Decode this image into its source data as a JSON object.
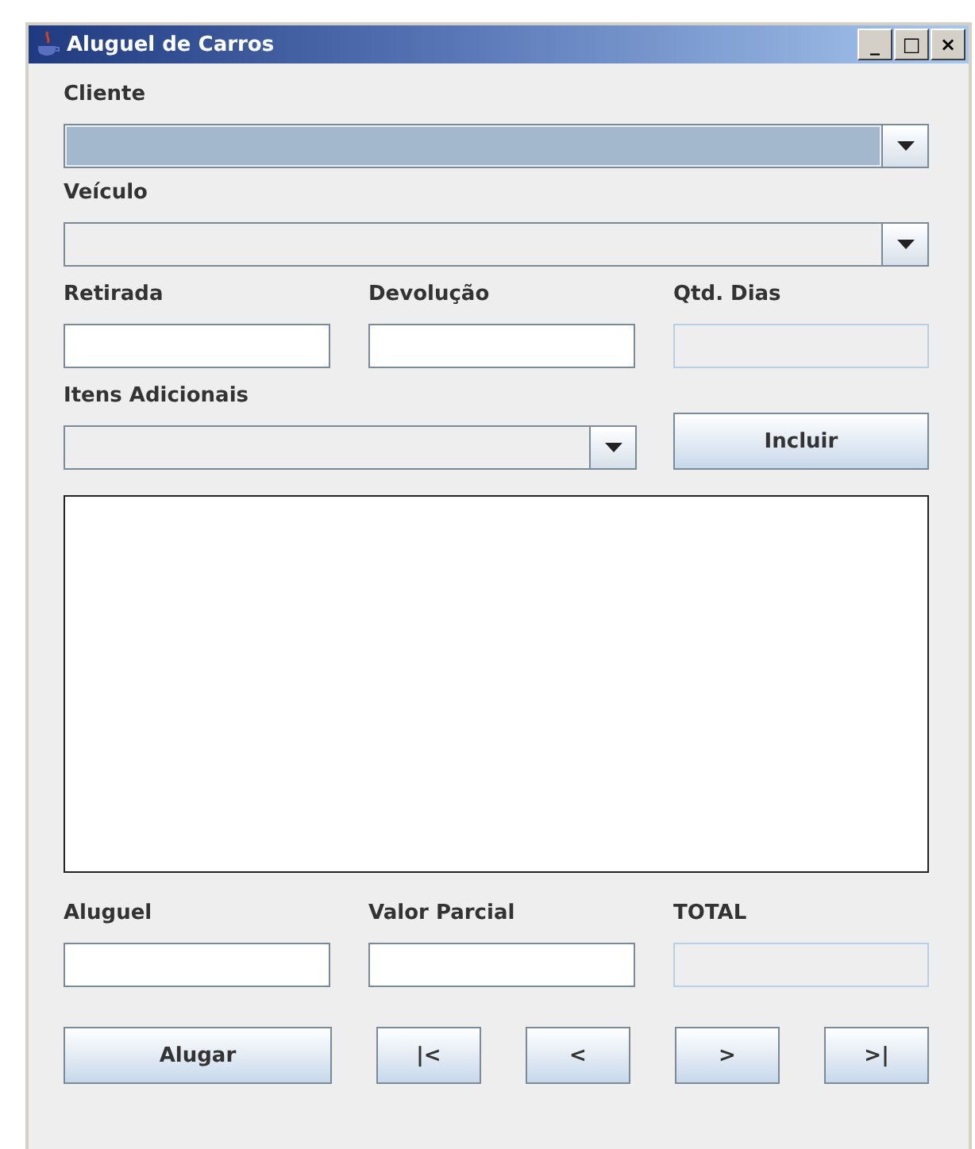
{
  "window": {
    "title": "Aluguel de Carros",
    "controls": [
      "_",
      "□",
      "×"
    ]
  },
  "combos": [
    {
      "label": "Cliente",
      "focused": true
    },
    {
      "label": "Veículo",
      "focused": false
    }
  ],
  "dates": [
    {
      "label": "Retirada",
      "disabled": false
    },
    {
      "label": "Devolução",
      "disabled": false
    },
    {
      "label": "Qtd. Dias",
      "disabled": true
    }
  ],
  "extras": {
    "label": "Itens Adicionais",
    "focused": false,
    "button": "Incluir"
  },
  "totals": [
    {
      "label": "Aluguel",
      "disabled": false
    },
    {
      "label": "Valor Parcial",
      "disabled": false
    },
    {
      "label": "TOTAL",
      "disabled": true
    }
  ],
  "buttons": [
    {
      "label": "Alugar",
      "kind": "wide"
    },
    {
      "label": "|<",
      "kind": "nav"
    },
    {
      "label": "<",
      "kind": "nav"
    },
    {
      "label": ">",
      "kind": "nav"
    },
    {
      "label": ">|",
      "kind": "nav"
    }
  ]
}
